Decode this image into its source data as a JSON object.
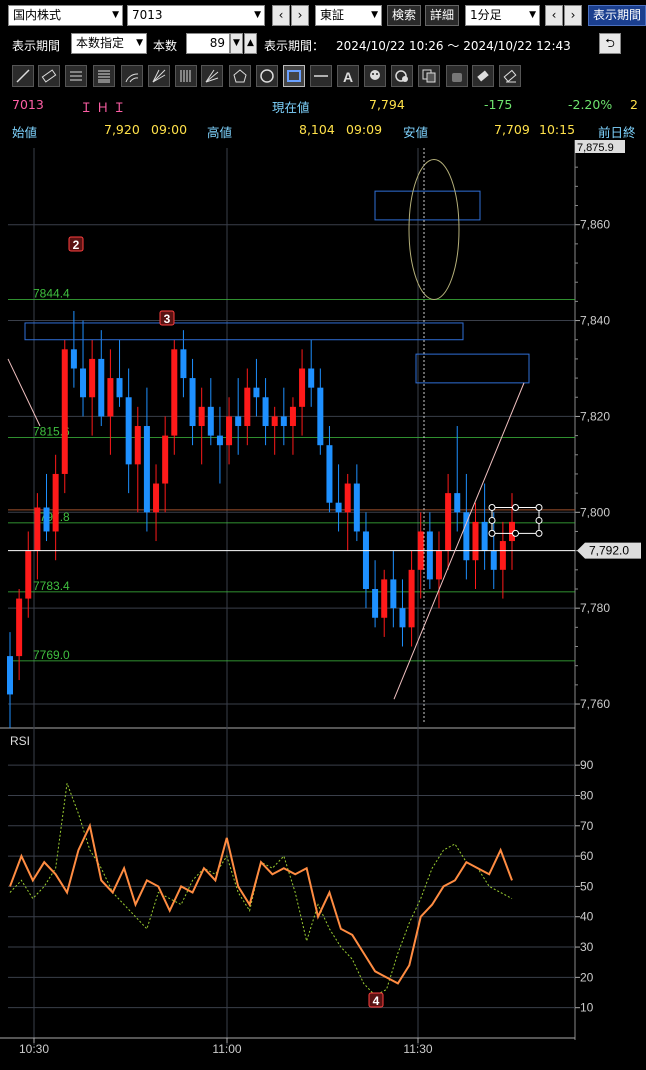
{
  "toolbar": {
    "market": "国内株式",
    "symbol": "7013",
    "exchange": "東証",
    "search": "検索",
    "detail": "詳細",
    "interval": "1分足",
    "display_period_btn": "表示期間",
    "prev": "‹",
    "next": "›"
  },
  "period_bar": {
    "label": "表示期間",
    "mode": "本数指定",
    "count_label": "本数",
    "count_value": "89",
    "range_label": "表示期間：",
    "range_value": "2024/10/22 10:26 〜 2024/10/22 12:43"
  },
  "tools": [
    "line-tool-icon",
    "ruler-tool-icon",
    "hlines-tool-icon",
    "fib-lines-tool-icon",
    "arc-tool-icon",
    "fan-tool-icon",
    "vlines-tool-icon",
    "gann-tool-icon",
    "pentagon-tool-icon",
    "circle-tool-icon",
    "rectangle-tool-icon",
    "hline-tool-icon",
    "text-tool-icon",
    "icon-tool-icon",
    "cycle-tool-icon",
    "copy-tool-icon",
    "hand-tool-icon",
    "eraser-tool-icon",
    "eraser-all-tool-icon"
  ],
  "quote": {
    "code": "7013",
    "name": "ＩＨＩ",
    "current_label": "現在値",
    "current_value": "7,794",
    "change": "-175",
    "change_pct": "-2.20%",
    "change_pct_suffix": "2",
    "open_label": "始値",
    "open_value": "7,920",
    "open_time": "09:00",
    "high_label": "高値",
    "high_value": "8,104",
    "high_time": "09:09",
    "low_label": "安値",
    "low_value": "7,709",
    "low_time": "10:15",
    "prev_close_label": "前日終"
  },
  "colors": {
    "up": "#ff1a1a",
    "down": "#1e90ff",
    "rsi_fast": "#ff8c42",
    "rsi_slow": "#9acd32",
    "fib": "#3fbf3f",
    "grid": "#3a3f4a",
    "rect": "#2f6fd6"
  },
  "chart_data": {
    "type": "candlestick",
    "price_axis": {
      "ticks": [
        "7,860",
        "7,840",
        "7,820",
        "7,800",
        "7,780",
        "7,760"
      ],
      "tick_values": [
        7860,
        7840,
        7820,
        7800,
        7780,
        7760
      ],
      "ylim": [
        7755,
        7876
      ]
    },
    "top_label": "7,875.9",
    "current_price_label": "7,792.0",
    "current_price": 7792,
    "fib_levels": [
      {
        "label": "7844.4",
        "value": 7844.4
      },
      {
        "label": "7815.6",
        "value": 7815.6
      },
      {
        "label": "7797.8",
        "value": 7797.8
      },
      {
        "label": "7783.4",
        "value": 7783.4
      },
      {
        "label": "7769.0",
        "value": 7769.0
      }
    ],
    "time_axis": [
      "10:30",
      "11:00",
      "11:30"
    ],
    "markers": [
      "2",
      "3",
      "4"
    ],
    "candles": [
      [
        7770,
        7775,
        7755,
        7762
      ],
      [
        7770,
        7784,
        7765,
        7782
      ],
      [
        7782,
        7796,
        7778,
        7792
      ],
      [
        7792,
        7804,
        7786,
        7801
      ],
      [
        7801,
        7808,
        7794,
        7796
      ],
      [
        7796,
        7812,
        7790,
        7808
      ],
      [
        7808,
        7836,
        7804,
        7834
      ],
      [
        7834,
        7842,
        7826,
        7830
      ],
      [
        7830,
        7840,
        7820,
        7824
      ],
      [
        7824,
        7836,
        7816,
        7832
      ],
      [
        7832,
        7838,
        7818,
        7820
      ],
      [
        7820,
        7834,
        7812,
        7828
      ],
      [
        7828,
        7836,
        7822,
        7824
      ],
      [
        7824,
        7830,
        7804,
        7810
      ],
      [
        7810,
        7822,
        7800,
        7818
      ],
      [
        7818,
        7826,
        7796,
        7800
      ],
      [
        7800,
        7810,
        7794,
        7806
      ],
      [
        7806,
        7820,
        7800,
        7816
      ],
      [
        7816,
        7836,
        7812,
        7834
      ],
      [
        7834,
        7838,
        7824,
        7828
      ],
      [
        7828,
        7832,
        7814,
        7818
      ],
      [
        7818,
        7826,
        7810,
        7822
      ],
      [
        7822,
        7828,
        7814,
        7816
      ],
      [
        7816,
        7822,
        7806,
        7814
      ],
      [
        7814,
        7824,
        7810,
        7820
      ],
      [
        7820,
        7828,
        7812,
        7818
      ],
      [
        7818,
        7830,
        7814,
        7826
      ],
      [
        7826,
        7832,
        7820,
        7824
      ],
      [
        7824,
        7828,
        7814,
        7818
      ],
      [
        7818,
        7822,
        7812,
        7820
      ],
      [
        7820,
        7826,
        7814,
        7818
      ],
      [
        7818,
        7824,
        7812,
        7822
      ],
      [
        7822,
        7834,
        7816,
        7830
      ],
      [
        7830,
        7836,
        7822,
        7826
      ],
      [
        7826,
        7830,
        7812,
        7814
      ],
      [
        7814,
        7818,
        7800,
        7802
      ],
      [
        7802,
        7810,
        7796,
        7800
      ],
      [
        7800,
        7808,
        7792,
        7806
      ],
      [
        7806,
        7810,
        7794,
        7796
      ],
      [
        7796,
        7800,
        7780,
        7784
      ],
      [
        7784,
        7790,
        7776,
        7778
      ],
      [
        7778,
        7788,
        7774,
        7786
      ],
      [
        7786,
        7792,
        7776,
        7780
      ],
      [
        7780,
        7786,
        7772,
        7776
      ],
      [
        7776,
        7792,
        7772,
        7788
      ],
      [
        7788,
        7800,
        7782,
        7796
      ],
      [
        7796,
        7800,
        7784,
        7786
      ],
      [
        7786,
        7796,
        7780,
        7792
      ],
      [
        7792,
        7808,
        7788,
        7804
      ],
      [
        7804,
        7818,
        7796,
        7800
      ],
      [
        7800,
        7808,
        7786,
        7790
      ],
      [
        7790,
        7802,
        7784,
        7798
      ],
      [
        7798,
        7806,
        7788,
        7792
      ],
      [
        7792,
        7800,
        7784,
        7788
      ],
      [
        7788,
        7798,
        7782,
        7794
      ],
      [
        7794,
        7804,
        7788,
        7798
      ]
    ],
    "rsi": {
      "label": "RSI",
      "axis": [
        "90",
        "80",
        "70",
        "60",
        "50",
        "40",
        "30",
        "20",
        "10"
      ],
      "axis_values": [
        90,
        80,
        70,
        60,
        50,
        40,
        30,
        20,
        10
      ],
      "fast": [
        50,
        60,
        52,
        58,
        54,
        48,
        62,
        70,
        52,
        48,
        56,
        44,
        52,
        50,
        42,
        50,
        48,
        56,
        52,
        66,
        50,
        44,
        58,
        54,
        56,
        54,
        56,
        40,
        48,
        36,
        34,
        28,
        22,
        20,
        18,
        24,
        40,
        44,
        50,
        52,
        58,
        56,
        54,
        62,
        52
      ],
      "slow": [
        48,
        52,
        46,
        50,
        56,
        84,
        74,
        62,
        56,
        48,
        44,
        40,
        36,
        48,
        46,
        44,
        52,
        56,
        54,
        60,
        48,
        42,
        58,
        56,
        60,
        48,
        32,
        44,
        36,
        30,
        26,
        18,
        14,
        16,
        28,
        38,
        46,
        56,
        62,
        64,
        58,
        56,
        50,
        48,
        46
      ]
    }
  }
}
